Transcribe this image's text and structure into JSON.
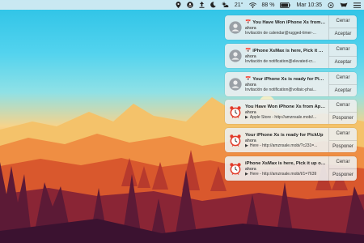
{
  "menubar": {
    "battery": "88 %",
    "temperature": "21°",
    "time": "Mar 10:35",
    "icons": [
      "location-icon",
      "amazon-icon",
      "upload-icon",
      "moon-icon",
      "weather-icon",
      "wifi-icon",
      "battery-icon",
      "menu-icon",
      "mirror-icon",
      "list-icon"
    ]
  },
  "notifications": [
    {
      "icon": "calendar-user-icon",
      "title": "You Have Won iPhone Xs from A...",
      "subtitle": "ahora",
      "body": "Invitación de calendar@rugged-timer-...",
      "action1": "Cerrar",
      "action2": "Aceptar"
    },
    {
      "icon": "calendar-user-icon",
      "title": "iPhone XsMax is here, Pick it up...",
      "subtitle": "ahora",
      "body": "Invitación de notification@elevated-cr...",
      "action1": "Cerrar",
      "action2": "Aceptar"
    },
    {
      "icon": "calendar-user-icon",
      "title": "Your iPhone Xs is ready for Pick...",
      "subtitle": "ahora",
      "body": "Invitación de notification@voltaic-phai...",
      "action1": "Cerrar",
      "action2": "Aceptar"
    },
    {
      "icon": "alarm-clock-icon",
      "title": "You Have Won iPhone Xs from Appl...",
      "subtitle": "ahora",
      "body": "Apple Store - http://amznsale.mobi/...",
      "action1": "Cerrar",
      "action2": "Posponer"
    },
    {
      "icon": "alarm-clock-icon",
      "title": "Your iPhone Xs is ready for PickUp",
      "subtitle": "ahora",
      "body": "Here - http://amznsale.mobi/?c231=...",
      "action1": "Cerrar",
      "action2": "Posponer"
    },
    {
      "icon": "alarm-clock-icon",
      "title": "iPhone XsMax is here, Pick it up or...",
      "subtitle": "ahora",
      "body": "Here - http://amznsale.mobi/t/1=7639",
      "action1": "Cerrar",
      "action2": "Posponer"
    }
  ]
}
